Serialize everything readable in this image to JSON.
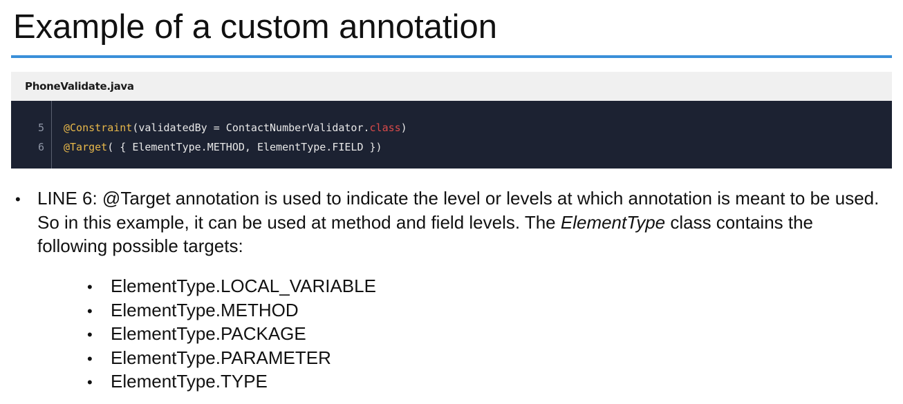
{
  "slide": {
    "title": "Example of a custom annotation"
  },
  "code_block": {
    "file_name": "PhoneValidate.java",
    "lines": [
      {
        "number": "5",
        "annotation": "@Constraint",
        "text_before_keyword": "(validatedBy = ContactNumberValidator.",
        "keyword": "class",
        "text_after_keyword": ")"
      },
      {
        "number": "6",
        "annotation": "@Target",
        "text": "( { ElementType.METHOD, ElementType.FIELD })"
      }
    ],
    "colors": {
      "background": "#1c2232",
      "header_background": "#f0f0f0",
      "annotation": "#e8b84a",
      "keyword": "#d94a4a"
    }
  },
  "explanation": {
    "bullet_symbol": "•",
    "text_prefix": "LINE 6: @Target annotation is used to indicate the level or levels at which annotation is meant to be used. So in this example, it can be used at method and field levels. The ",
    "emphasis": "ElementType",
    "text_suffix": " class contains the following possible targets:",
    "targets": [
      "ElementType.LOCAL_VARIABLE",
      "ElementType.METHOD",
      "ElementType.PACKAGE",
      "ElementType.PARAMETER",
      "ElementType.TYPE"
    ]
  },
  "accent_color": "#3a8fd9"
}
